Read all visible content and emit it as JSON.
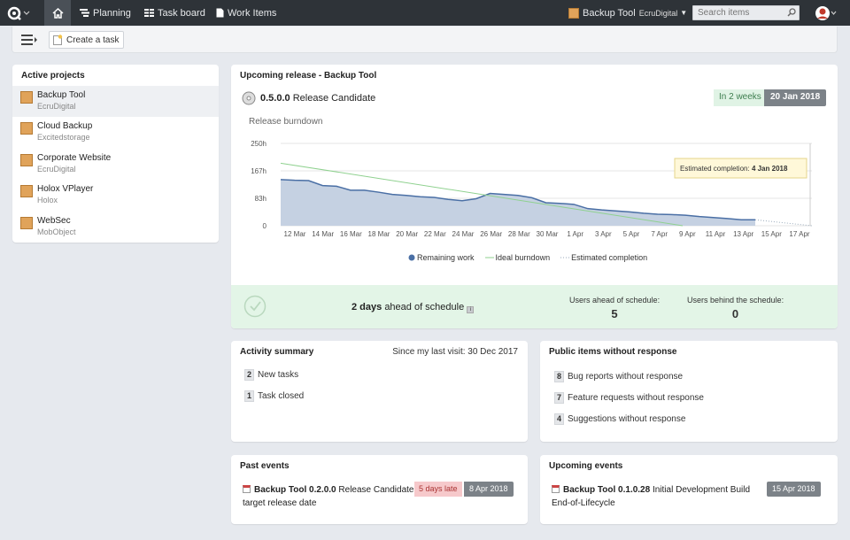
{
  "nav": {
    "planning": "Planning",
    "taskboard": "Task board",
    "workitems": "Work Items",
    "project_name": "Backup Tool",
    "project_org": "EcruDigital",
    "search_placeholder": "Search items"
  },
  "toolbar": {
    "create_task": "Create a task"
  },
  "projects": {
    "title": "Active projects",
    "items": [
      {
        "name": "Backup Tool",
        "org": "EcruDigital"
      },
      {
        "name": "Cloud Backup",
        "org": "Excitedstorage"
      },
      {
        "name": "Corporate Website",
        "org": "EcruDigital"
      },
      {
        "name": "Holox VPlayer",
        "org": "Holox"
      },
      {
        "name": "WebSec",
        "org": "MobObject"
      }
    ]
  },
  "release": {
    "title": "Upcoming release - Backup Tool",
    "version": "0.5.0.0",
    "type": "Release Candidate",
    "when": "In 2 weeks",
    "date": "20 Jan 2018",
    "burndown_title": "Release burndown",
    "ahead_bold": "2 days",
    "ahead_rest": "ahead of schedule",
    "users_ahead_label": "Users ahead of schedule:",
    "users_ahead": "5",
    "users_behind_label": "Users behind the schedule:",
    "users_behind": "0"
  },
  "chart_data": {
    "type": "area",
    "title": "Release burndown",
    "categories": [
      "12 Mar",
      "14 Mar",
      "16 Mar",
      "18 Mar",
      "20 Mar",
      "22 Mar",
      "24 Mar",
      "26 Mar",
      "28 Mar",
      "30 Mar",
      "1 Apr",
      "3 Apr",
      "5 Apr",
      "7 Apr",
      "9 Apr",
      "11 Apr",
      "13 Apr",
      "15 Apr",
      "17 Apr"
    ],
    "yticks": [
      "250h",
      "167h",
      "83h",
      "0"
    ],
    "ylim": [
      0,
      250
    ],
    "series": [
      {
        "name": "Remaining work",
        "type": "area",
        "color": "#4a6fa5",
        "values": [
          140,
          138,
          137,
          122,
          120,
          108,
          108,
          102,
          95,
          92,
          88,
          86,
          80,
          76,
          82,
          98,
          95,
          92,
          85,
          70,
          68,
          65,
          52,
          48,
          45,
          42,
          38,
          35,
          34,
          32,
          28,
          25,
          22,
          18,
          18
        ]
      },
      {
        "name": "Ideal burndown",
        "type": "line",
        "color": "#8fd18f",
        "start": 190,
        "end": 0
      },
      {
        "name": "Estimated completion",
        "type": "dotted",
        "color": "#9ab"
      }
    ],
    "tooltip_label": "Estimated completion:",
    "tooltip_value": "4 Jan 2018",
    "legend_position": "bottom"
  },
  "activity": {
    "title": "Activity summary",
    "since": "Since my last visit: 30 Dec 2017",
    "items": [
      {
        "count": "2",
        "label": "New tasks"
      },
      {
        "count": "1",
        "label": "Task closed"
      }
    ]
  },
  "public": {
    "title": "Public items without response",
    "items": [
      {
        "count": "8",
        "label": "Bug reports without response"
      },
      {
        "count": "7",
        "label": "Feature requests without response"
      },
      {
        "count": "4",
        "label": "Suggestions without response"
      }
    ]
  },
  "past": {
    "title": "Past events",
    "name": "Backup Tool 0.2.0.0",
    "type": "Release Candidate",
    "sub": "target release date",
    "late": "5 days late",
    "date": "8 Apr 2018"
  },
  "upcoming": {
    "title": "Upcoming events",
    "name": "Backup Tool 0.1.0.28",
    "type": "Initial Development Build",
    "sub": "End-of-Lifecycle",
    "date": "15 Apr 2018"
  }
}
